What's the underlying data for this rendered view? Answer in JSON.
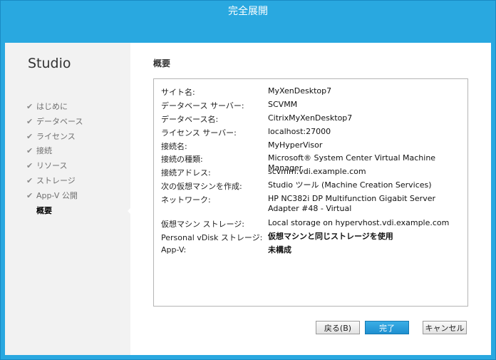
{
  "window": {
    "title": "完全展開"
  },
  "sidebar": {
    "title": "Studio",
    "items": [
      {
        "label": "はじめに",
        "done": true
      },
      {
        "label": "データベース",
        "done": true
      },
      {
        "label": "ライセンス",
        "done": true
      },
      {
        "label": "接続",
        "done": true
      },
      {
        "label": "リソース",
        "done": true
      },
      {
        "label": "ストレージ",
        "done": true
      },
      {
        "label": "App-V 公開",
        "done": true
      },
      {
        "label": "概要",
        "done": false,
        "active": true
      }
    ]
  },
  "main": {
    "heading": "概要",
    "summary": [
      {
        "label": "サイト名:",
        "value": "MyXenDesktop7"
      },
      {
        "label": "データベース サーバー:",
        "value": "SCVMM"
      },
      {
        "label": "データベース名:",
        "value": "CitrixMyXenDesktop7"
      },
      {
        "label": "ライセンス サーバー:",
        "value": "localhost:27000"
      },
      {
        "label": "接続名:",
        "value": "MyHyperVisor"
      },
      {
        "label": "接続の種類:",
        "value": "Microsoft® System Center Virtual Machine Manager"
      },
      {
        "label": "接続アドレス:",
        "value": "scvmm.vdi.example.com"
      },
      {
        "label": "次の仮想マシンを作成:",
        "value": "Studio ツール (Machine Creation Services)"
      },
      {
        "label": "ネットワーク:",
        "value": "HP NC382i DP Multifunction Gigabit Server Adapter #48 - Virtual"
      },
      {
        "label": "仮想マシン ストレージ:",
        "value": "Local storage on hypervhost.vdi.example.com"
      },
      {
        "label": "Personal vDisk ストレージ:",
        "value": "仮想マシンと同じストレージを使用"
      },
      {
        "label": "App-V:",
        "value": "未構成"
      }
    ]
  },
  "buttons": {
    "back": "戻る(B)",
    "finish": "完了",
    "cancel": "キャンセル"
  },
  "colors": {
    "chrome": "#29a8e0",
    "primary_button": "#1e8fd0",
    "sidebar_bg": "#f2f2f2"
  }
}
